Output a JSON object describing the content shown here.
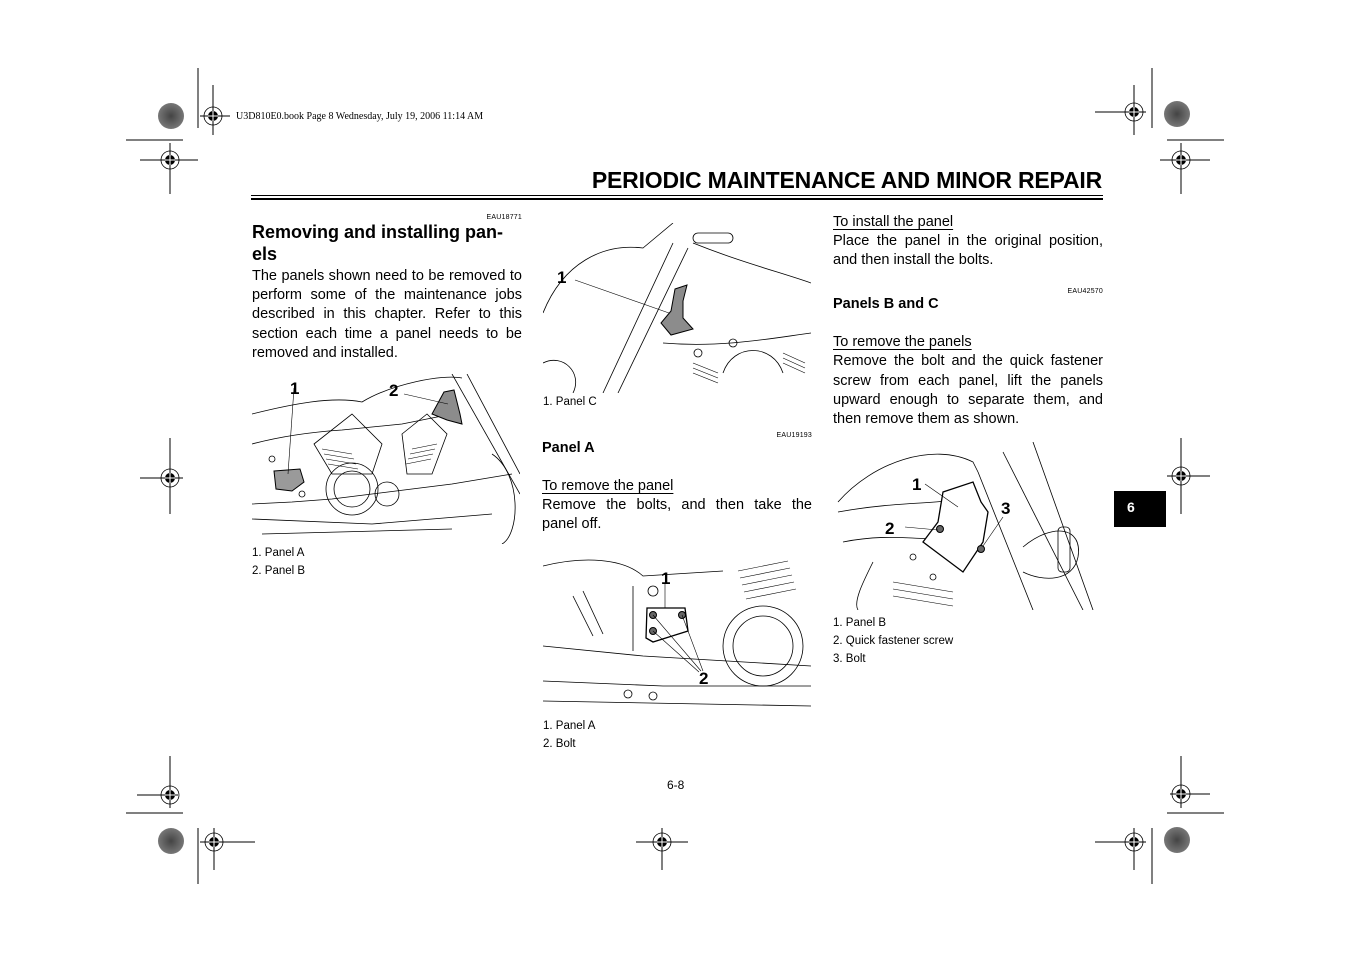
{
  "file_header": "U3D810E0.book  Page 8  Wednesday, July 19, 2006  11:14 AM",
  "page_title": "PERIODIC MAINTENANCE AND MINOR REPAIR",
  "chapter_tab": "6",
  "page_number": "6-8",
  "col1": {
    "code": "EAU18771",
    "heading_line1": "Removing and installing pan-",
    "heading_line2": "els",
    "body": "The panels shown need to be removed to perform some of the maintenance jobs described in this chapter. Refer to this section each time a panel needs to be removed and installed.",
    "figure": {
      "callouts": [
        "1",
        "2"
      ],
      "captions": [
        "1.  Panel A",
        "2.  Panel B"
      ]
    }
  },
  "col2": {
    "figure_top": {
      "callouts": [
        "1"
      ],
      "captions": [
        "1.  Panel C"
      ]
    },
    "code": "EAU19193",
    "heading": "Panel A",
    "subheading": "To remove the panel",
    "body": "Remove the bolts, and then take the panel off.",
    "figure_bottom": {
      "callouts": [
        "1",
        "2"
      ],
      "captions": [
        "1.  Panel A",
        "2.  Bolt"
      ]
    }
  },
  "col3": {
    "subheading_install": "To install the panel",
    "body_install": "Place the panel in the original position, and then install the bolts.",
    "code": "EAU42570",
    "heading": "Panels B and C",
    "subheading_remove": "To remove the panels",
    "body_remove": "Remove the bolt and the quick fastener screw from each panel, lift the panels upward enough to separate them, and then remove them as shown.",
    "figure": {
      "callouts": [
        "1",
        "2",
        "3"
      ],
      "captions": [
        "1.  Panel B",
        "2.  Quick fastener screw",
        "3.  Bolt"
      ]
    }
  },
  "colors": {
    "text": "#000000",
    "panel_fill": "#8c8c8c",
    "tab_bg": "#000000",
    "tab_text": "#ffffff"
  }
}
